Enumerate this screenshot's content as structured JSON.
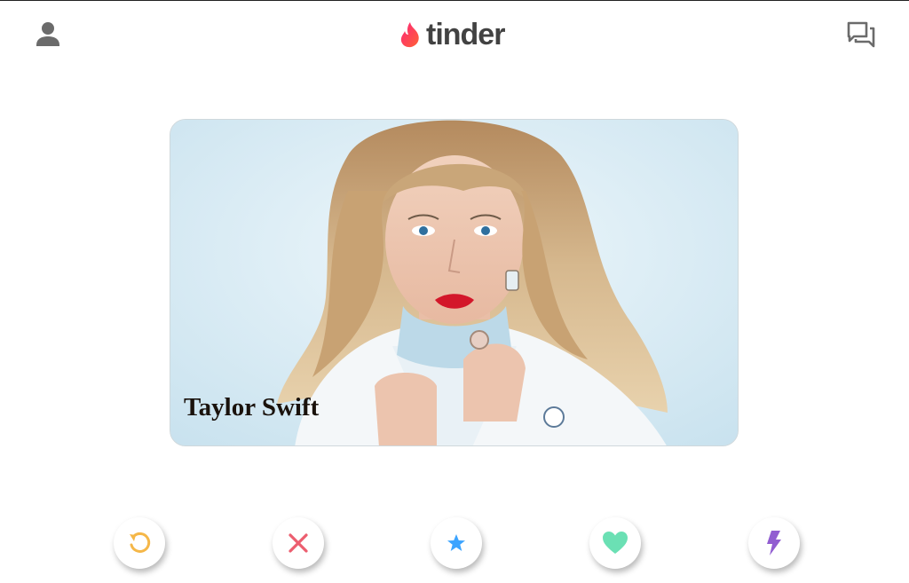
{
  "header": {
    "profile_icon": "person-icon",
    "logo_icon": "flame-icon",
    "logo_text": "tinder",
    "chat_icon": "chat-bubbles-icon"
  },
  "card": {
    "name": "Taylor Swift",
    "photo": "profile-photo"
  },
  "actions": [
    {
      "name": "rewind",
      "icon": "rewind-icon",
      "color": "#f5b748"
    },
    {
      "name": "nope",
      "icon": "close-icon",
      "color": "#ec5e6f"
    },
    {
      "name": "super-like",
      "icon": "star-icon",
      "color": "#3ca4ff"
    },
    {
      "name": "like",
      "icon": "heart-icon",
      "color": "#6be0b4"
    },
    {
      "name": "boost",
      "icon": "lightning-icon",
      "color": "#915dd1"
    }
  ],
  "colors": {
    "brand_gradient_start": "#fd267a",
    "brand_gradient_end": "#ff6036",
    "header_icon": "#6b6b6b",
    "logo_text": "#424242"
  }
}
